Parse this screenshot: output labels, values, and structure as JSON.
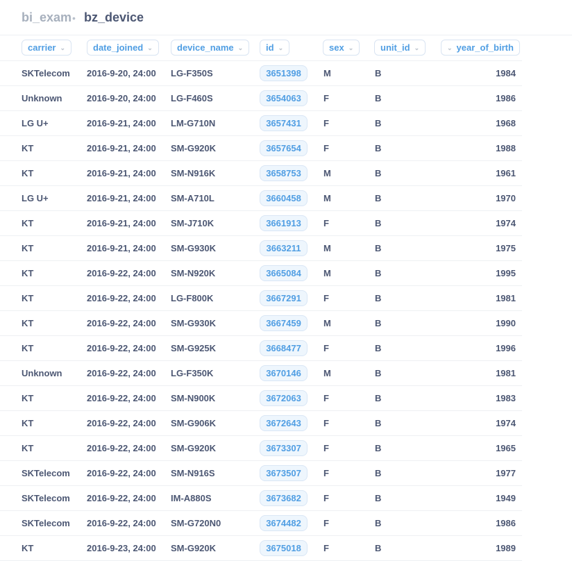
{
  "breadcrumb": {
    "database": "bi_exam",
    "separator": "•",
    "table": "bz_device"
  },
  "columns": [
    {
      "label": "carrier"
    },
    {
      "label": "date_joined"
    },
    {
      "label": "device_name"
    },
    {
      "label": "id"
    },
    {
      "label": "sex"
    },
    {
      "label": "unit_id"
    },
    {
      "label": "year_of_birth"
    }
  ],
  "rows": [
    {
      "carrier": "SKTelecom",
      "date_joined": "2016-9-20, 24:00",
      "device_name": "LG-F350S",
      "id": "3651398",
      "sex": "M",
      "unit_id": "B",
      "year_of_birth": "1984"
    },
    {
      "carrier": "Unknown",
      "date_joined": "2016-9-20, 24:00",
      "device_name": "LG-F460S",
      "id": "3654063",
      "sex": "F",
      "unit_id": "B",
      "year_of_birth": "1986"
    },
    {
      "carrier": "LG U+",
      "date_joined": "2016-9-21, 24:00",
      "device_name": "LM-G710N",
      "id": "3657431",
      "sex": "F",
      "unit_id": "B",
      "year_of_birth": "1968"
    },
    {
      "carrier": "KT",
      "date_joined": "2016-9-21, 24:00",
      "device_name": "SM-G920K",
      "id": "3657654",
      "sex": "F",
      "unit_id": "B",
      "year_of_birth": "1988"
    },
    {
      "carrier": "KT",
      "date_joined": "2016-9-21, 24:00",
      "device_name": "SM-N916K",
      "id": "3658753",
      "sex": "M",
      "unit_id": "B",
      "year_of_birth": "1961"
    },
    {
      "carrier": "LG U+",
      "date_joined": "2016-9-21, 24:00",
      "device_name": "SM-A710L",
      "id": "3660458",
      "sex": "M",
      "unit_id": "B",
      "year_of_birth": "1970"
    },
    {
      "carrier": "KT",
      "date_joined": "2016-9-21, 24:00",
      "device_name": "SM-J710K",
      "id": "3661913",
      "sex": "F",
      "unit_id": "B",
      "year_of_birth": "1974"
    },
    {
      "carrier": "KT",
      "date_joined": "2016-9-21, 24:00",
      "device_name": "SM-G930K",
      "id": "3663211",
      "sex": "M",
      "unit_id": "B",
      "year_of_birth": "1975"
    },
    {
      "carrier": "KT",
      "date_joined": "2016-9-22, 24:00",
      "device_name": "SM-N920K",
      "id": "3665084",
      "sex": "M",
      "unit_id": "B",
      "year_of_birth": "1995"
    },
    {
      "carrier": "KT",
      "date_joined": "2016-9-22, 24:00",
      "device_name": "LG-F800K",
      "id": "3667291",
      "sex": "F",
      "unit_id": "B",
      "year_of_birth": "1981"
    },
    {
      "carrier": "KT",
      "date_joined": "2016-9-22, 24:00",
      "device_name": "SM-G930K",
      "id": "3667459",
      "sex": "M",
      "unit_id": "B",
      "year_of_birth": "1990"
    },
    {
      "carrier": "KT",
      "date_joined": "2016-9-22, 24:00",
      "device_name": "SM-G925K",
      "id": "3668477",
      "sex": "F",
      "unit_id": "B",
      "year_of_birth": "1996"
    },
    {
      "carrier": "Unknown",
      "date_joined": "2016-9-22, 24:00",
      "device_name": "LG-F350K",
      "id": "3670146",
      "sex": "M",
      "unit_id": "B",
      "year_of_birth": "1981"
    },
    {
      "carrier": "KT",
      "date_joined": "2016-9-22, 24:00",
      "device_name": "SM-N900K",
      "id": "3672063",
      "sex": "F",
      "unit_id": "B",
      "year_of_birth": "1983"
    },
    {
      "carrier": "KT",
      "date_joined": "2016-9-22, 24:00",
      "device_name": "SM-G906K",
      "id": "3672643",
      "sex": "F",
      "unit_id": "B",
      "year_of_birth": "1974"
    },
    {
      "carrier": "KT",
      "date_joined": "2016-9-22, 24:00",
      "device_name": "SM-G920K",
      "id": "3673307",
      "sex": "F",
      "unit_id": "B",
      "year_of_birth": "1965"
    },
    {
      "carrier": "SKTelecom",
      "date_joined": "2016-9-22, 24:00",
      "device_name": "SM-N916S",
      "id": "3673507",
      "sex": "F",
      "unit_id": "B",
      "year_of_birth": "1977"
    },
    {
      "carrier": "SKTelecom",
      "date_joined": "2016-9-22, 24:00",
      "device_name": "IM-A880S",
      "id": "3673682",
      "sex": "F",
      "unit_id": "B",
      "year_of_birth": "1949"
    },
    {
      "carrier": "SKTelecom",
      "date_joined": "2016-9-22, 24:00",
      "device_name": "SM-G720N0",
      "id": "3674482",
      "sex": "F",
      "unit_id": "B",
      "year_of_birth": "1986"
    },
    {
      "carrier": "KT",
      "date_joined": "2016-9-23, 24:00",
      "device_name": "SM-G920K",
      "id": "3675018",
      "sex": "F",
      "unit_id": "B",
      "year_of_birth": "1989"
    }
  ]
}
